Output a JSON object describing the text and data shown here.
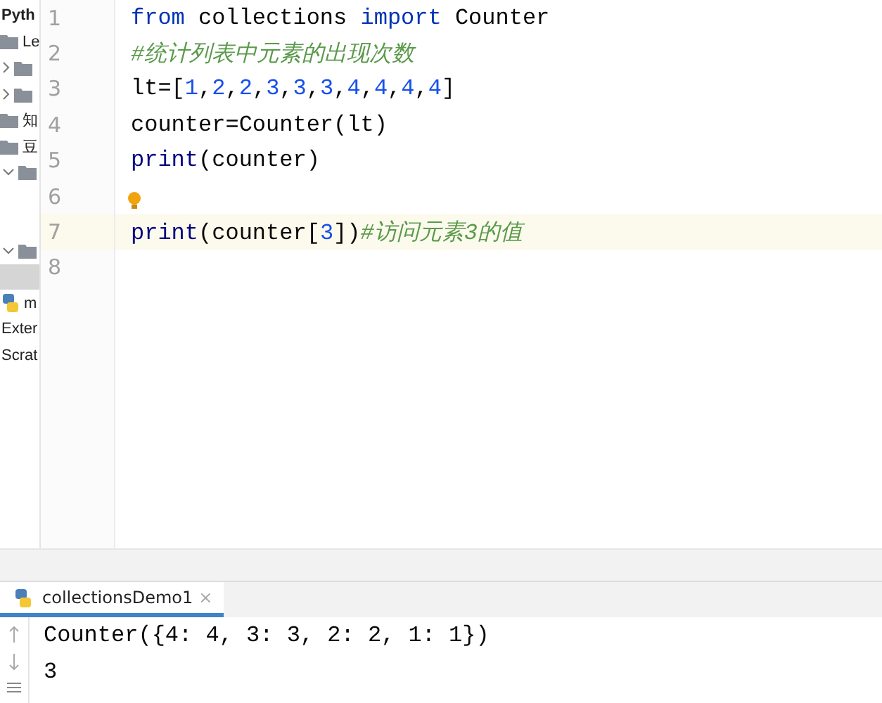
{
  "project_tree": [
    {
      "label": "Pyth",
      "kind": "header",
      "selected": false
    },
    {
      "label": "Le",
      "kind": "folder",
      "selected": false
    },
    {
      "kind": "folder-collapsed",
      "selected": false
    },
    {
      "kind": "folder-collapsed",
      "selected": false
    },
    {
      "label": "知",
      "kind": "folder",
      "selected": false
    },
    {
      "label": "豆",
      "kind": "folder",
      "selected": false
    },
    {
      "kind": "folder-expanded",
      "selected": false
    },
    {
      "kind": "folder-expanded",
      "selected": false
    },
    {
      "kind": "blank",
      "selected": true
    },
    {
      "label": "m",
      "kind": "python",
      "selected": false
    },
    {
      "label": "Exter",
      "kind": "text",
      "selected": false
    },
    {
      "label": "Scrat",
      "kind": "text",
      "selected": false
    }
  ],
  "editor": {
    "lines": [
      {
        "number": "1",
        "current": false,
        "bulb": false,
        "tokens": [
          {
            "kind": "keyword",
            "text": "from"
          },
          {
            "kind": "plain",
            "text": " collections "
          },
          {
            "kind": "keyword",
            "text": "import"
          },
          {
            "kind": "plain",
            "text": " Counter"
          }
        ]
      },
      {
        "number": "2",
        "current": false,
        "bulb": false,
        "tokens": [
          {
            "kind": "comment",
            "text": "#统计列表中元素的出现次数"
          }
        ]
      },
      {
        "number": "3",
        "current": false,
        "bulb": false,
        "tokens": [
          {
            "kind": "plain",
            "text": "lt=["
          },
          {
            "kind": "number",
            "text": "1"
          },
          {
            "kind": "plain",
            "text": ","
          },
          {
            "kind": "number",
            "text": "2"
          },
          {
            "kind": "plain",
            "text": ","
          },
          {
            "kind": "number",
            "text": "2"
          },
          {
            "kind": "plain",
            "text": ","
          },
          {
            "kind": "number",
            "text": "3"
          },
          {
            "kind": "plain",
            "text": ","
          },
          {
            "kind": "number",
            "text": "3"
          },
          {
            "kind": "plain",
            "text": ","
          },
          {
            "kind": "number",
            "text": "3"
          },
          {
            "kind": "plain",
            "text": ","
          },
          {
            "kind": "number",
            "text": "4"
          },
          {
            "kind": "plain",
            "text": ","
          },
          {
            "kind": "number",
            "text": "4"
          },
          {
            "kind": "plain",
            "text": ","
          },
          {
            "kind": "number",
            "text": "4"
          },
          {
            "kind": "plain",
            "text": ","
          },
          {
            "kind": "number",
            "text": "4"
          },
          {
            "kind": "plain",
            "text": "]"
          }
        ]
      },
      {
        "number": "4",
        "current": false,
        "bulb": false,
        "tokens": [
          {
            "kind": "plain",
            "text": "counter=Counter(lt)"
          }
        ]
      },
      {
        "number": "5",
        "current": false,
        "bulb": false,
        "tokens": [
          {
            "kind": "function",
            "text": "print"
          },
          {
            "kind": "plain",
            "text": "(counter)"
          }
        ]
      },
      {
        "number": "6",
        "current": false,
        "bulb": true
      },
      {
        "number": "7",
        "current": true,
        "bulb": false,
        "tokens": [
          {
            "kind": "function",
            "text": "print"
          },
          {
            "kind": "plain",
            "text": "(counter["
          },
          {
            "kind": "number",
            "text": "3"
          },
          {
            "kind": "plain",
            "text": "])"
          },
          {
            "kind": "comment",
            "text": "#访问元素3的值"
          }
        ]
      },
      {
        "number": "8",
        "current": false,
        "bulb": false
      }
    ]
  },
  "run_panel": {
    "tabs": [
      {
        "label": "collectionsDemo1",
        "close": "×",
        "selected": true
      }
    ],
    "output": [
      "Counter({4: 4, 3: 3, 2: 2, 1: 1})",
      "3"
    ]
  }
}
